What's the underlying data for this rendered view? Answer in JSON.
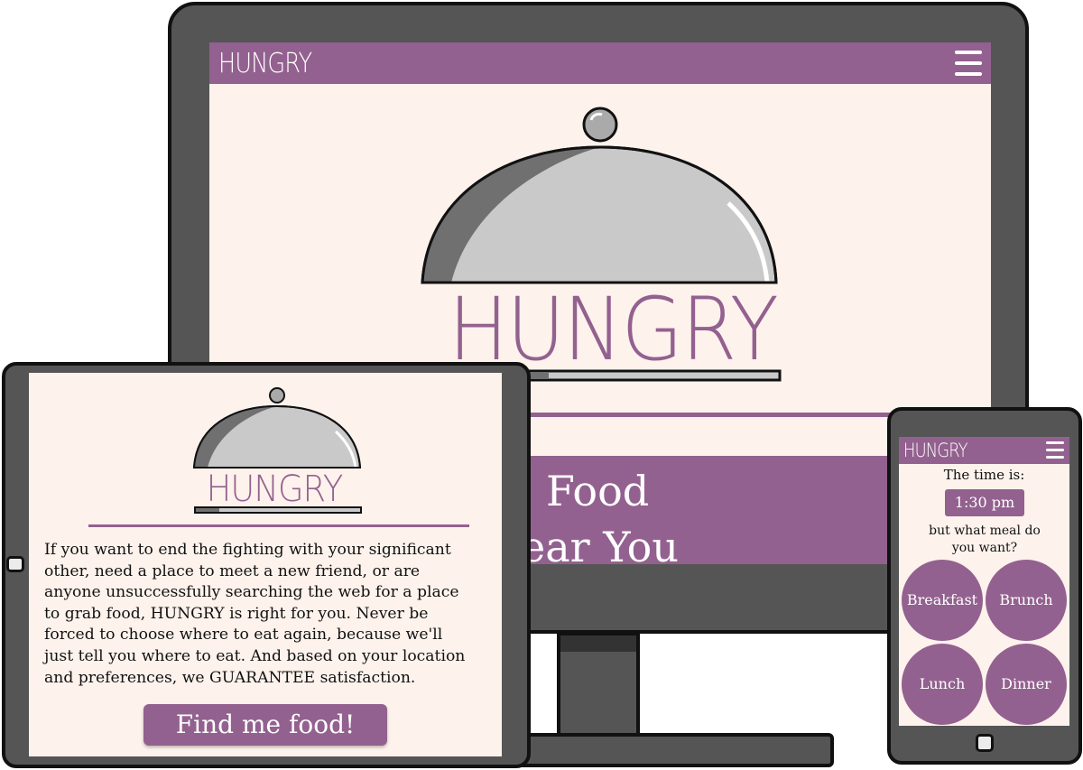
{
  "colors": {
    "brand": "#93618f",
    "screen": "#fdf2ec",
    "frame": "#555555"
  },
  "desktop": {
    "header": {
      "brand": "HUNGRY",
      "menu_icon": "hamburger-icon"
    },
    "hero": {
      "logo_text": "HUNGRY",
      "icon": "cloche-icon"
    },
    "banner": {
      "line1": "Food",
      "line2": "Near You",
      "line2_visible": "ear You"
    }
  },
  "tablet": {
    "hero": {
      "logo_text": "HUNGRY",
      "icon": "cloche-icon"
    },
    "copy": [
      "If you want to end the fighting with your significant",
      "other, need a place to meet a new friend, or are",
      "anyone unsuccessfully  searching the web for a place",
      "to grab food, HUNGRY is right for you.  Never be",
      "forced to choose where to eat again, because we'll",
      "just tell you where to eat. And based on your location",
      "and preferences, we GUARANTEE satisfaction."
    ],
    "cta": "Find me food!"
  },
  "phone": {
    "header": {
      "brand": "HUNGRY",
      "menu_icon": "hamburger-icon"
    },
    "time_label": "The time is:",
    "time_value": "1:30 pm",
    "question": "but what meal do you want?",
    "meals": [
      "Breakfast",
      "Brunch",
      "Lunch",
      "Dinner"
    ]
  }
}
